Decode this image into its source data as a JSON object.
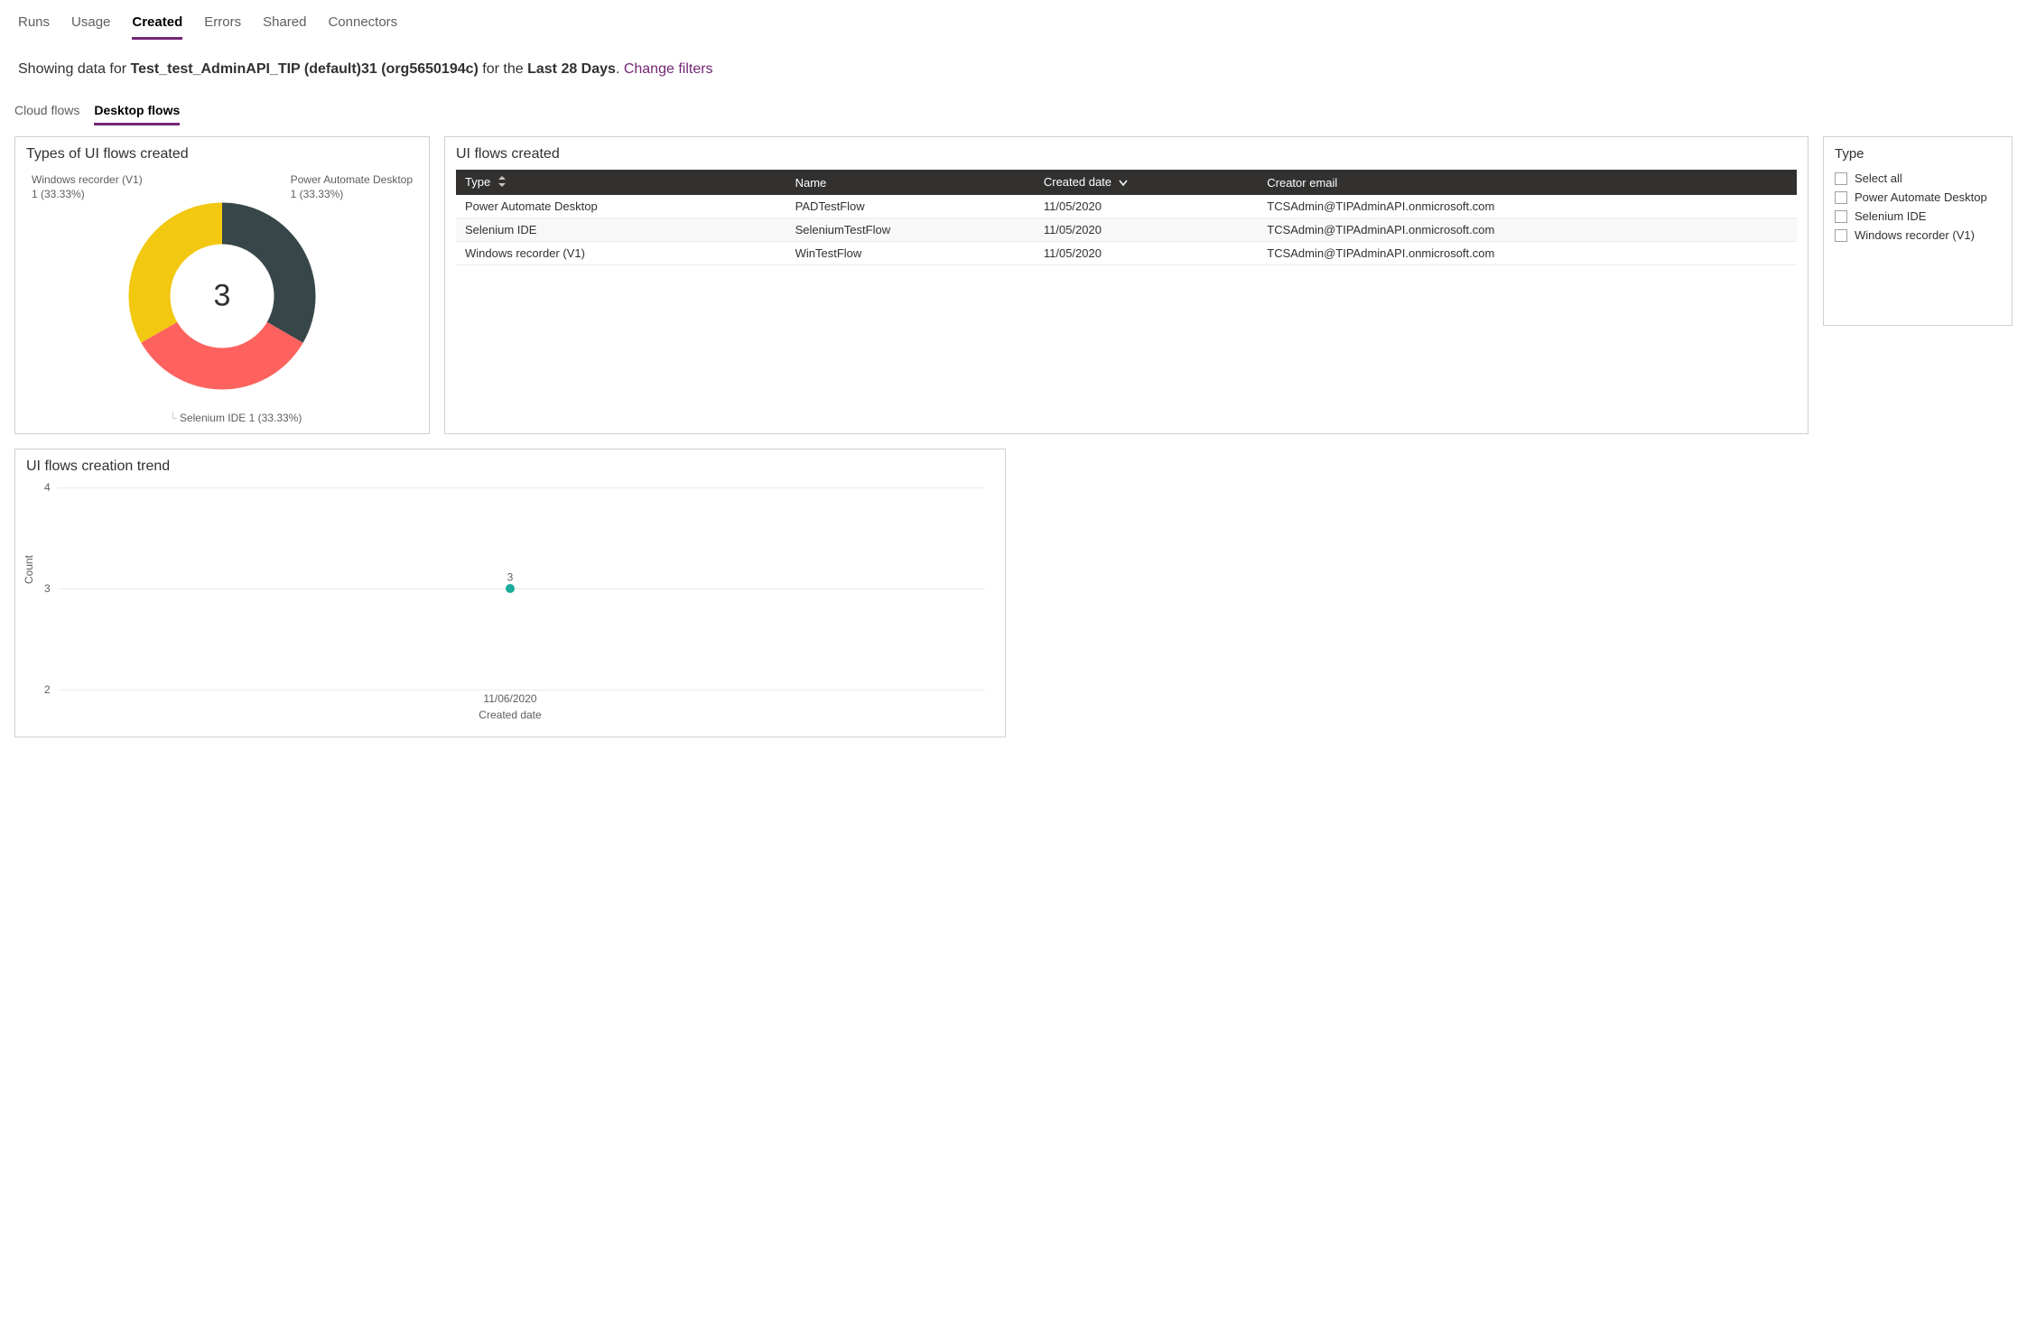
{
  "top_tabs": {
    "runs": "Runs",
    "usage": "Usage",
    "created": "Created",
    "errors": "Errors",
    "shared": "Shared",
    "connectors": "Connectors",
    "active": "created"
  },
  "filter_bar": {
    "prefix": "Showing data for ",
    "env_name": "Test_test_AdminAPI_TIP (default)31 (org5650194c)",
    "middle": " for the ",
    "period": "Last 28 Days",
    "suffix": ". ",
    "change_link": "Change filters"
  },
  "sub_tabs": {
    "cloud": "Cloud flows",
    "desktop": "Desktop flows",
    "active": "desktop"
  },
  "donut": {
    "title": "Types of UI flows created",
    "center": "3",
    "labels": {
      "top_left_line1": "Windows recorder (V1)",
      "top_left_line2": "1 (33.33%)",
      "top_right_line1": "Power Automate Desktop",
      "top_right_line2": "1 (33.33%)",
      "bottom_line": "Selenium IDE 1 (33.33%)"
    }
  },
  "table": {
    "title": "UI flows created",
    "headers": {
      "type": "Type",
      "name": "Name",
      "created": "Created date",
      "creator": "Creator email"
    },
    "rows": [
      {
        "type": "Power Automate Desktop",
        "name": "PADTestFlow",
        "created": "11/05/2020",
        "creator": "TCSAdmin@TIPAdminAPI.onmicrosoft.com"
      },
      {
        "type": "Selenium IDE",
        "name": "SeleniumTestFlow",
        "created": "11/05/2020",
        "creator": "TCSAdmin@TIPAdminAPI.onmicrosoft.com"
      },
      {
        "type": "Windows recorder (V1)",
        "name": "WinTestFlow",
        "created": "11/05/2020",
        "creator": "TCSAdmin@TIPAdminAPI.onmicrosoft.com"
      }
    ]
  },
  "type_filter": {
    "title": "Type",
    "options": {
      "all": "Select all",
      "pad": "Power Automate Desktop",
      "sel": "Selenium IDE",
      "win": "Windows recorder (V1)"
    }
  },
  "trend": {
    "title": "UI flows creation trend",
    "ylabel": "Count",
    "xlabel": "Created date",
    "yticks": {
      "t4": "4",
      "t3": "3",
      "t2": "2"
    },
    "xtick": "11/06/2020",
    "point_label": "3"
  },
  "chart_data": [
    {
      "type": "pie",
      "title": "Types of UI flows created",
      "categories": [
        "Windows recorder (V1)",
        "Power Automate Desktop",
        "Selenium IDE"
      ],
      "values": [
        1,
        1,
        1
      ],
      "percentages": [
        33.33,
        33.33,
        33.33
      ],
      "total": 3,
      "colors": [
        "#f2c811",
        "#374649",
        "#fd625e"
      ]
    },
    {
      "type": "table",
      "title": "UI flows created",
      "columns": [
        "Type",
        "Name",
        "Created date",
        "Creator email"
      ],
      "rows": [
        [
          "Power Automate Desktop",
          "PADTestFlow",
          "11/05/2020",
          "TCSAdmin@TIPAdminAPI.onmicrosoft.com"
        ],
        [
          "Selenium IDE",
          "SeleniumTestFlow",
          "11/05/2020",
          "TCSAdmin@TIPAdminAPI.onmicrosoft.com"
        ],
        [
          "Windows recorder (V1)",
          "WinTestFlow",
          "11/05/2020",
          "TCSAdmin@TIPAdminAPI.onmicrosoft.com"
        ]
      ]
    },
    {
      "type": "scatter",
      "title": "UI flows creation trend",
      "xlabel": "Created date",
      "ylabel": "Count",
      "ylim": [
        2,
        4
      ],
      "x": [
        "11/06/2020"
      ],
      "values": [
        3
      ],
      "color": "#1aab9b"
    }
  ]
}
